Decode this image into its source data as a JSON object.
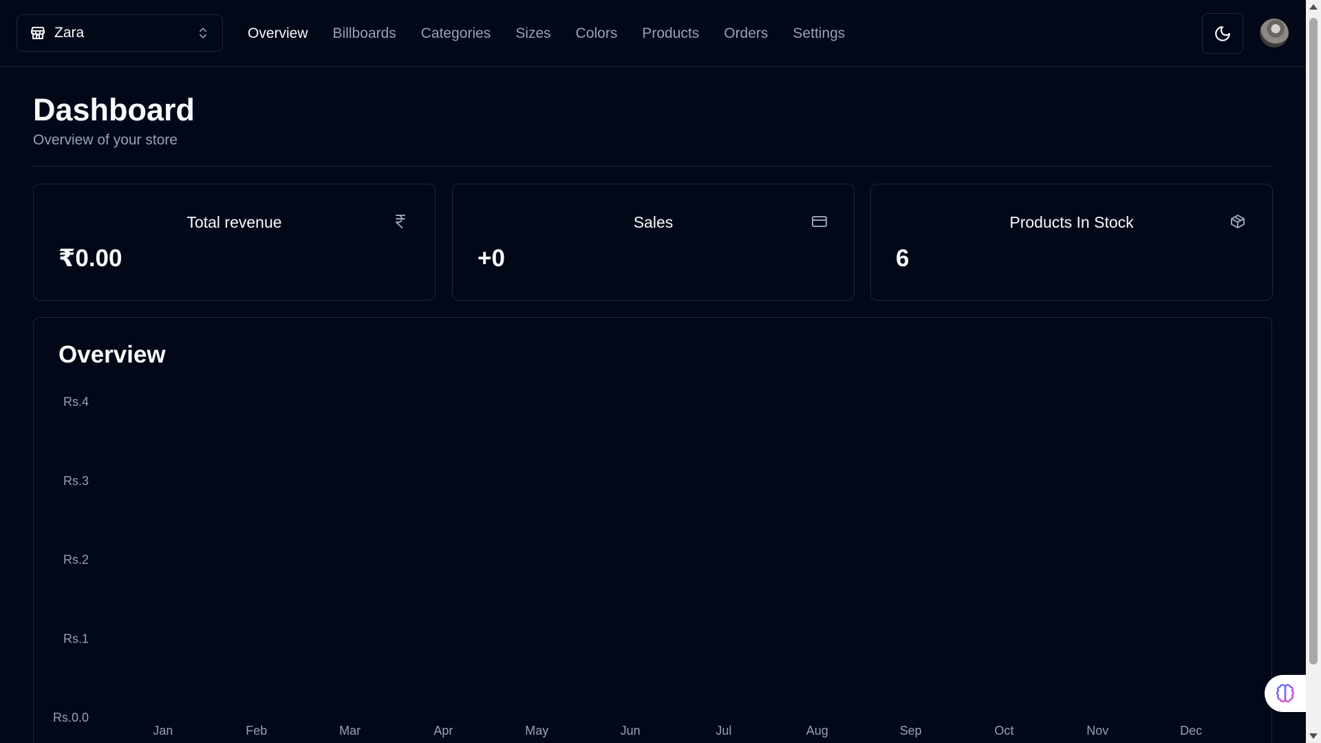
{
  "store_switcher": {
    "name": "Zara"
  },
  "nav": {
    "items": [
      {
        "label": "Overview",
        "active": true
      },
      {
        "label": "Billboards"
      },
      {
        "label": "Categories"
      },
      {
        "label": "Sizes"
      },
      {
        "label": "Colors"
      },
      {
        "label": "Products"
      },
      {
        "label": "Orders"
      },
      {
        "label": "Settings"
      }
    ]
  },
  "page": {
    "title": "Dashboard",
    "subtitle": "Overview of your store"
  },
  "cards": [
    {
      "title": "Total revenue",
      "value": "₹0.00",
      "icon": "rupee-icon"
    },
    {
      "title": "Sales",
      "value": "+0",
      "icon": "credit-card-icon"
    },
    {
      "title": "Products In Stock",
      "value": "6",
      "icon": "package-icon"
    }
  ],
  "overview": {
    "title": "Overview"
  },
  "chart_data": {
    "type": "bar",
    "categories": [
      "Jan",
      "Feb",
      "Mar",
      "Apr",
      "May",
      "Jun",
      "Jul",
      "Aug",
      "Sep",
      "Oct",
      "Nov",
      "Dec"
    ],
    "values": [
      0,
      0,
      0,
      0,
      0,
      0,
      0,
      0,
      0,
      0,
      0,
      0
    ],
    "ytick_labels": [
      "Rs.0.0",
      "Rs.1",
      "Rs.2",
      "Rs.3",
      "Rs.4"
    ],
    "ylim": [
      0,
      4
    ],
    "grid": false,
    "bar_color": "#adfa1d"
  },
  "colors": {
    "background": "#020817",
    "border": "#1e293b",
    "muted": "#94a3b8",
    "foreground": "#f8fafc"
  }
}
